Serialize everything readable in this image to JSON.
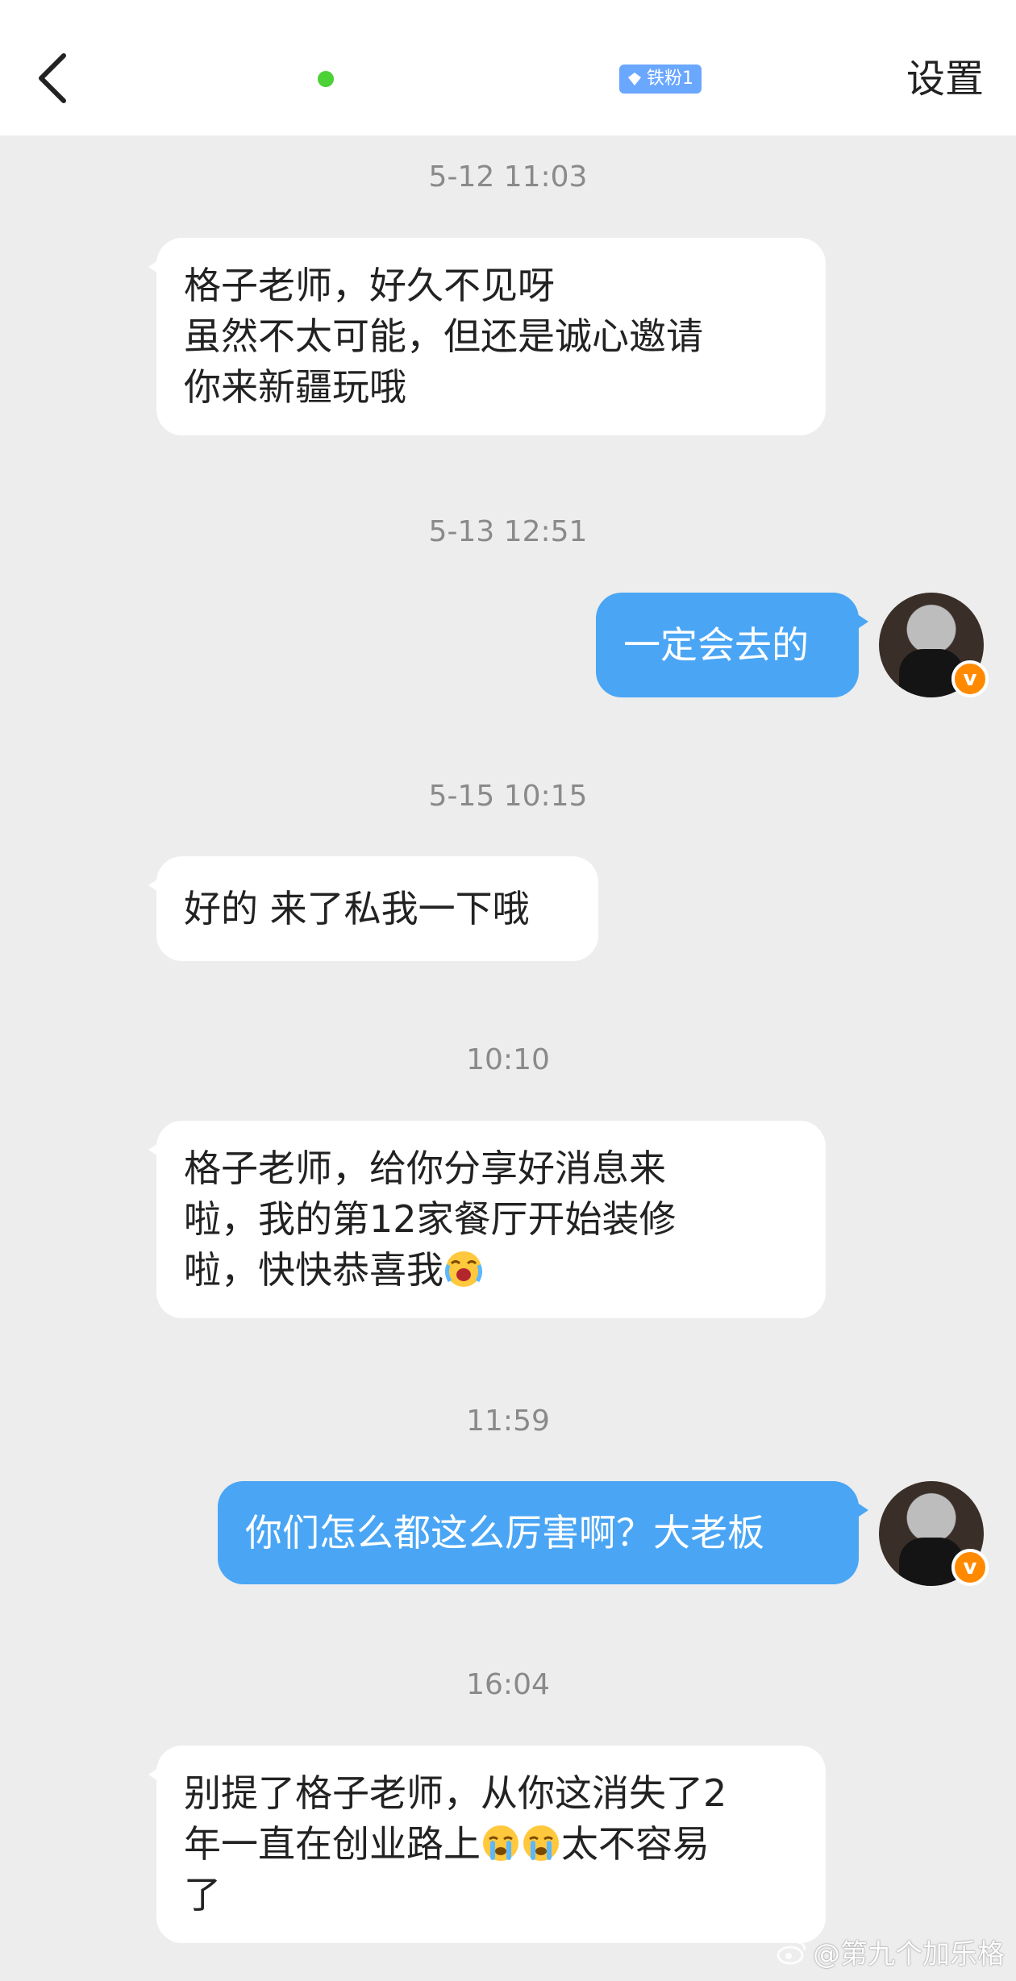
{
  "header": {
    "fan_badge": "铁粉1",
    "settings_label": "设置"
  },
  "messages": [
    {
      "timestamp": "5-12 11:03",
      "from": "them",
      "lines": [
        "格子老师，好久不见呀",
        "虽然不太可能，但还是诚心邀请",
        "你来新疆玩哦"
      ]
    },
    {
      "timestamp": "5-13 12:51",
      "from": "me",
      "lines": [
        "一定会去的"
      ]
    },
    {
      "timestamp": "5-15 10:15",
      "from": "them",
      "lines": [
        "好的 来了私我一下哦"
      ]
    },
    {
      "timestamp": "10:10",
      "from": "them",
      "lines": [
        "格子老师，给你分享好消息来",
        "啦，我的第12家餐厅开始装修",
        "啦，快快恭喜我"
      ],
      "emojis": [
        "excited-cry-emoji"
      ]
    },
    {
      "timestamp": "11:59",
      "from": "me",
      "lines": [
        "你们怎么都这么厉害啊？大老板"
      ]
    },
    {
      "timestamp": "16:04",
      "from": "them",
      "lines": [
        "别提了格子老师，从你这消失了2",
        "年一直在创业路上",
        "太不容易",
        "了"
      ],
      "emojis": [
        "crying-emoji",
        "crying-emoji"
      ]
    }
  ],
  "watermark": "@第九个加乐格",
  "colors": {
    "outgoing_bubble": "#4aa6f5",
    "incoming_bubble": "#ffffff",
    "background": "#ededed",
    "online_dot": "#4cd137",
    "fan_badge": "#6aa7ff",
    "verified_badge": "#ff8a00"
  }
}
